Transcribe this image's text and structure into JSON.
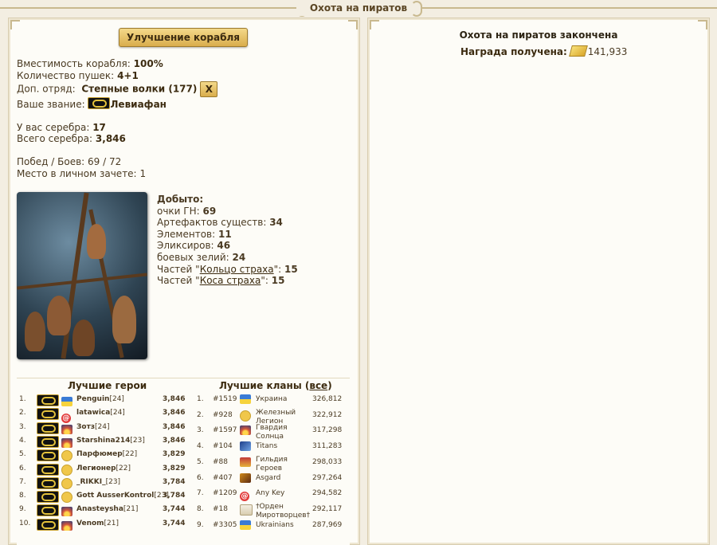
{
  "window": {
    "title": "Охота на пиратов"
  },
  "left": {
    "upgrade_button": "Улучшение корабля",
    "stats": [
      {
        "label": "Вместимость корабля:",
        "value": "100%"
      },
      {
        "label": "Количество пушек:",
        "value": "4+1"
      }
    ],
    "squad": {
      "label": "Доп. отряд:",
      "value": "Степные волки (177)",
      "remove_button": "X"
    },
    "rank": {
      "label": "Ваше звание:",
      "value": "Левиафан",
      "icon": "rank-emblem-icon"
    },
    "silver": {
      "have_label": "У вас серебра:",
      "have_value": "17",
      "total_label": "Всего серебра:",
      "total_value": "3,846"
    },
    "battles": {
      "label": "Побед / Боев:",
      "value": "69 / 72"
    },
    "place": {
      "label": "Место в личном зачете:",
      "value": "1"
    },
    "loot": {
      "title": "Добыто:",
      "items": [
        {
          "label": "очки ГН:",
          "value": "69"
        },
        {
          "label": "Артефактов существ:",
          "value": "34"
        },
        {
          "label": "Элементов:",
          "value": "11"
        },
        {
          "label": "Эликсиров:",
          "value": "46"
        },
        {
          "label": "боевых зелий:",
          "value": "24"
        }
      ],
      "parts": [
        {
          "prefix": "Частей \"",
          "link": "Кольцо страха",
          "suffix": "\":",
          "value": "15"
        },
        {
          "prefix": "Частей \"",
          "link": "Коса страха",
          "suffix": "\":",
          "value": "15"
        }
      ]
    },
    "heroes": {
      "title": "Лучшие герои",
      "rows": [
        {
          "n": "1.",
          "name": "Penguin",
          "lvl": "[24]",
          "val": "3,846",
          "fac": "ukraine-flag-icon"
        },
        {
          "n": "2.",
          "name": "latawica",
          "lvl": "[24]",
          "val": "3,846",
          "fac": "at-icon"
        },
        {
          "n": "3.",
          "name": "Зотз",
          "lvl": "[24]",
          "val": "3,846",
          "fac": "sunrise-icon"
        },
        {
          "n": "4.",
          "name": "Starshina214",
          "lvl": "[23]",
          "val": "3,846",
          "fac": "sunrise-icon"
        },
        {
          "n": "5.",
          "name": "Парфюмер",
          "lvl": "[22]",
          "val": "3,829",
          "fac": "smile-icon"
        },
        {
          "n": "6.",
          "name": "Легионер",
          "lvl": "[22]",
          "val": "3,829",
          "fac": "smile-icon"
        },
        {
          "n": "7.",
          "name": "_RIKKI_",
          "lvl": "[23]",
          "val": "3,784",
          "fac": "smile-icon"
        },
        {
          "n": "8.",
          "name": "Gott AusserKontrol",
          "lvl": "[23]",
          "val": "3,784",
          "fac": "smile-icon"
        },
        {
          "n": "9.",
          "name": "Anasteysha",
          "lvl": "[21]",
          "val": "3,744",
          "fac": "sunrise-icon"
        },
        {
          "n": "10.",
          "name": "Venom",
          "lvl": "[21]",
          "val": "3,744",
          "fac": "sunrise-icon"
        }
      ]
    },
    "clans": {
      "title": "Лучшие кланы (",
      "all_link": "все",
      "title_end": ")",
      "rows": [
        {
          "n": "1.",
          "pos": "#1519",
          "name": "Украина",
          "val": "326,812",
          "icon": "ukraine-flag-icon"
        },
        {
          "n": "2.",
          "pos": "#928",
          "name": "Железный Легион",
          "val": "322,912",
          "icon": "smile-icon"
        },
        {
          "n": "3.",
          "pos": "#1597",
          "name": "Гвардия Солнца",
          "val": "317,298",
          "icon": "sunrise-icon"
        },
        {
          "n": "4.",
          "pos": "#104",
          "name": "Titans",
          "val": "311,283",
          "icon": "titans-icon"
        },
        {
          "n": "5.",
          "pos": "#88",
          "name": "Гильдия Героев",
          "val": "298,033",
          "icon": "guild-shield-icon"
        },
        {
          "n": "6.",
          "pos": "#407",
          "name": "Asgard",
          "val": "297,264",
          "icon": "asgard-icon"
        },
        {
          "n": "7.",
          "pos": "#1209",
          "name": "Any Key",
          "val": "294,582",
          "icon": "at-icon"
        },
        {
          "n": "8.",
          "pos": "#18",
          "name": "†Орден Миротворцев†",
          "val": "292,117",
          "icon": "cross-icon"
        },
        {
          "n": "9.",
          "pos": "#3305",
          "name": "Ukrainians",
          "val": "287,969",
          "icon": "ukraine-flag-icon"
        }
      ]
    }
  },
  "right": {
    "title": "Охота на пиратов закончена",
    "reward_label": "Награда получена:",
    "reward_value": "141,933",
    "reward_icon": "gold-bar-icon"
  }
}
